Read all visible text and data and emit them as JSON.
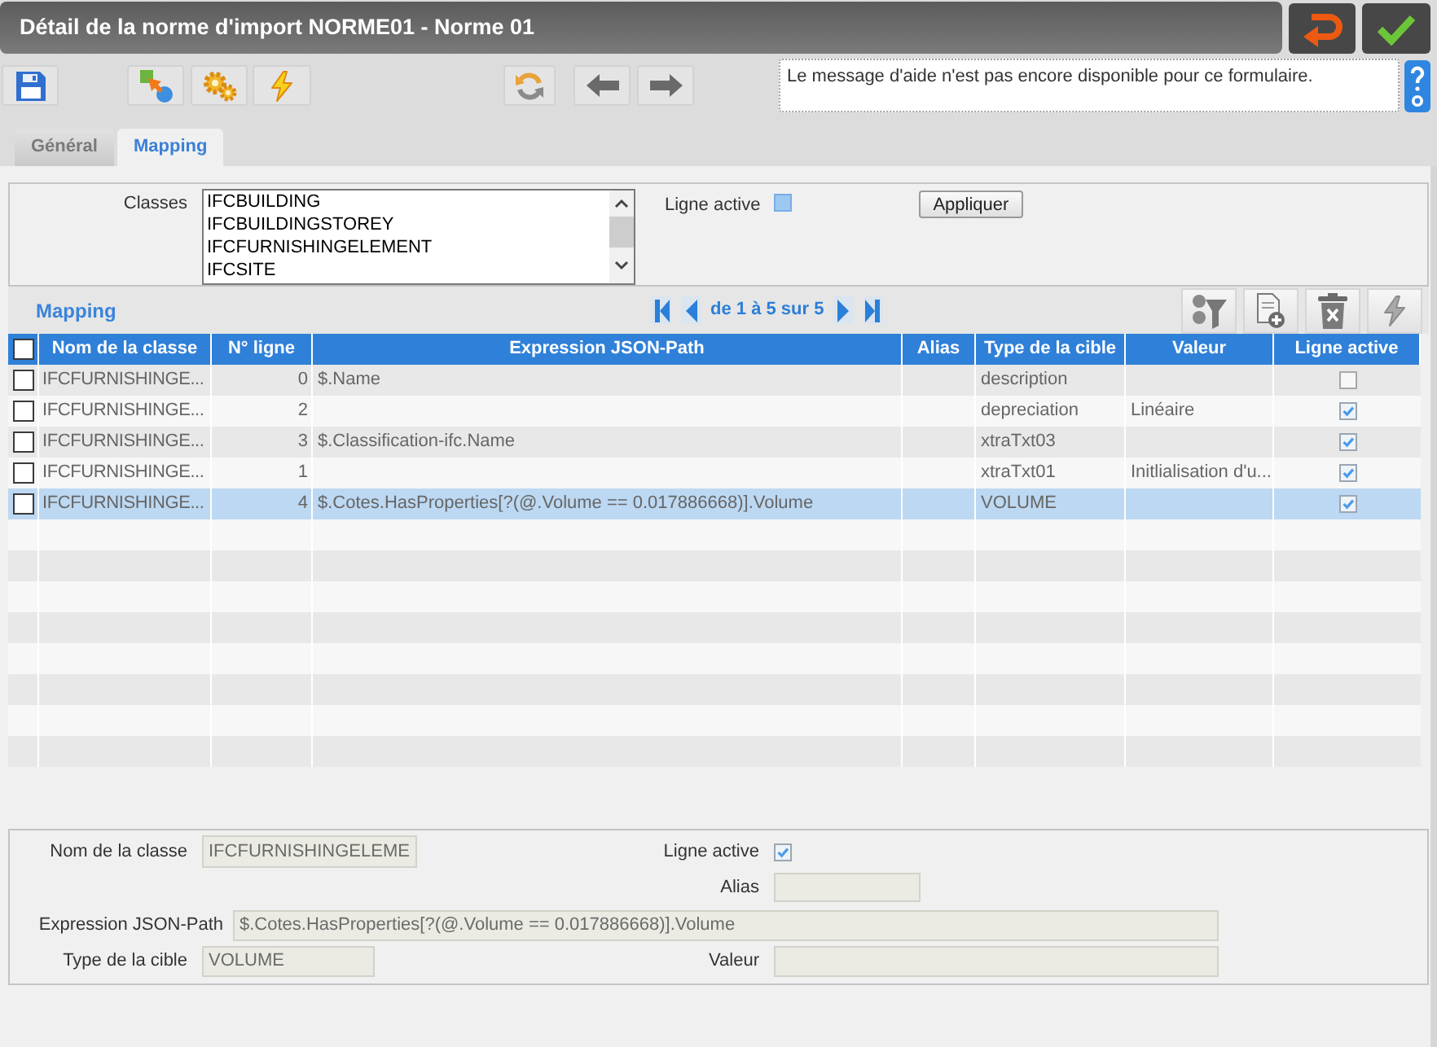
{
  "window": {
    "title": "Détail de la norme d'import NORME01 - Norme 01"
  },
  "help": {
    "message": "Le message d'aide n'est pas encore disponible pour ce formulaire."
  },
  "tabs": [
    {
      "label": "Général",
      "selected": false
    },
    {
      "label": "Mapping",
      "selected": true
    }
  ],
  "filter": {
    "classes_label": "Classes",
    "classes": [
      {
        "label": "IFCBUILDING",
        "selected": false
      },
      {
        "label": "IFCBUILDINGSTOREY",
        "selected": false
      },
      {
        "label": "IFCFURNISHINGELEMENT",
        "selected": false
      },
      {
        "label": "IFCSITE",
        "selected": false
      }
    ],
    "active_label": "Ligne active",
    "active_indeterminate": true,
    "apply_button": "Appliquer"
  },
  "mapping": {
    "title": "Mapping",
    "pagination": "de 1 à 5 sur 5",
    "tools": [
      {
        "kind": "sort",
        "disabled": false
      },
      {
        "kind": "add",
        "disabled": false
      },
      {
        "kind": "delete",
        "disabled": false
      },
      {
        "kind": "run",
        "disabled": true
      }
    ]
  },
  "table": {
    "select_all_checked": false,
    "columns": [
      "Nom de la classe",
      "N° ligne",
      "Expression JSON-Path",
      "Alias",
      "Type de la cible",
      "Valeur",
      "Ligne active"
    ],
    "rows": [
      {
        "checked": false,
        "selected": false,
        "class_name": "IFCFURNISHINGE...",
        "line": "0",
        "expression": "$.Name",
        "target_type": "description",
        "active": false
      },
      {
        "checked": false,
        "selected": false,
        "class_name": "IFCFURNISHINGE...",
        "line": "2",
        "target_type": "depreciation",
        "value": "Linéaire",
        "active": true
      },
      {
        "checked": false,
        "selected": false,
        "class_name": "IFCFURNISHINGE...",
        "line": "3",
        "expression": "$.Classification-ifc.Name",
        "target_type": "xtraTxt03",
        "active": true
      },
      {
        "checked": false,
        "selected": false,
        "class_name": "IFCFURNISHINGE...",
        "line": "1",
        "target_type": "xtraTxt01",
        "value": "Initlialisation d'u...",
        "active": true
      },
      {
        "checked": false,
        "selected": true,
        "class_name": "IFCFURNISHINGE...",
        "line": "4",
        "expression": "$.Cotes.HasProperties[?(@.Volume == 0.017886668)].Volume",
        "target_type": "VOLUME",
        "active": true
      }
    ]
  },
  "detail": {
    "class_label": "Nom de la classe",
    "class_value": "IFCFURNISHINGELEME",
    "active_label": "Ligne active",
    "active_checked": true,
    "alias_label": "Alias",
    "expression_label": "Expression JSON-Path",
    "expression_value": "$.Cotes.HasProperties[?(@.Volume == 0.017886668)].Volume",
    "target_label": "Type de la cible",
    "target_value": "VOLUME",
    "value_label": "Valeur"
  }
}
